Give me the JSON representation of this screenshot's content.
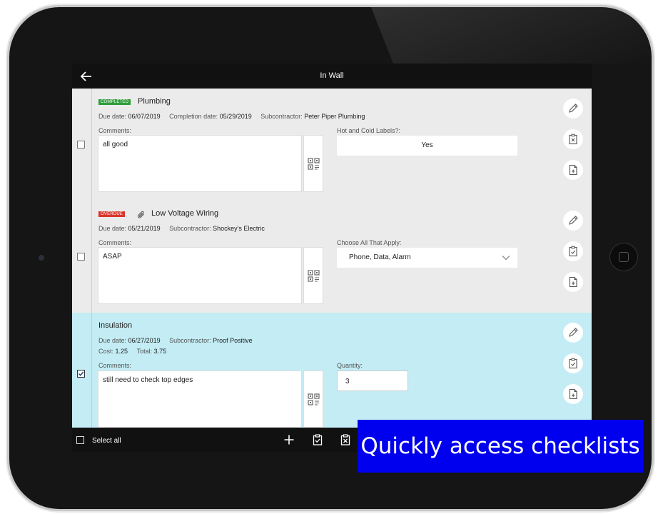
{
  "header": {
    "title": "In Wall"
  },
  "items": [
    {
      "badge": "COMPLETED",
      "title": "Plumbing",
      "due_label": "Due date:",
      "due": "06/07/2019",
      "completion_label": "Completion date:",
      "completion": "05/29/2019",
      "sub_label": "Subcontractor:",
      "sub": "Peter Piper Plumbing",
      "comments_label": "Comments:",
      "comments": "all good",
      "question": "Hot and Cold Labels?:",
      "answer": "Yes",
      "checked": false
    },
    {
      "badge": "OVERDUE",
      "title": "Low Voltage Wiring",
      "due_label": "Due date:",
      "due": "05/21/2019",
      "sub_label": "Subcontractor:",
      "sub": "Shockey's Electric",
      "comments_label": "Comments:",
      "comments": "ASAP",
      "question": "Choose All That Apply:",
      "answer": "Phone, Data, Alarm",
      "checked": false
    },
    {
      "title": "Insulation",
      "due_label": "Due date:",
      "due": "06/27/2019",
      "sub_label": "Subcontractor:",
      "sub": "Proof Positive",
      "cost_label": "Cost:",
      "cost": "1.25",
      "total_label": "Total:",
      "total": "3.75",
      "comments_label": "Comments:",
      "comments": "still need to check top edges",
      "question": "Quantity:",
      "answer": "3",
      "checked": true
    }
  ],
  "footer": {
    "select_all": "Select all"
  },
  "banner": {
    "text": "Quickly access checklists"
  },
  "colors": {
    "completed": "#2e9d3a",
    "overdue": "#d9352b",
    "selected_row": "#c3ecf4",
    "banner": "#0000ee"
  }
}
